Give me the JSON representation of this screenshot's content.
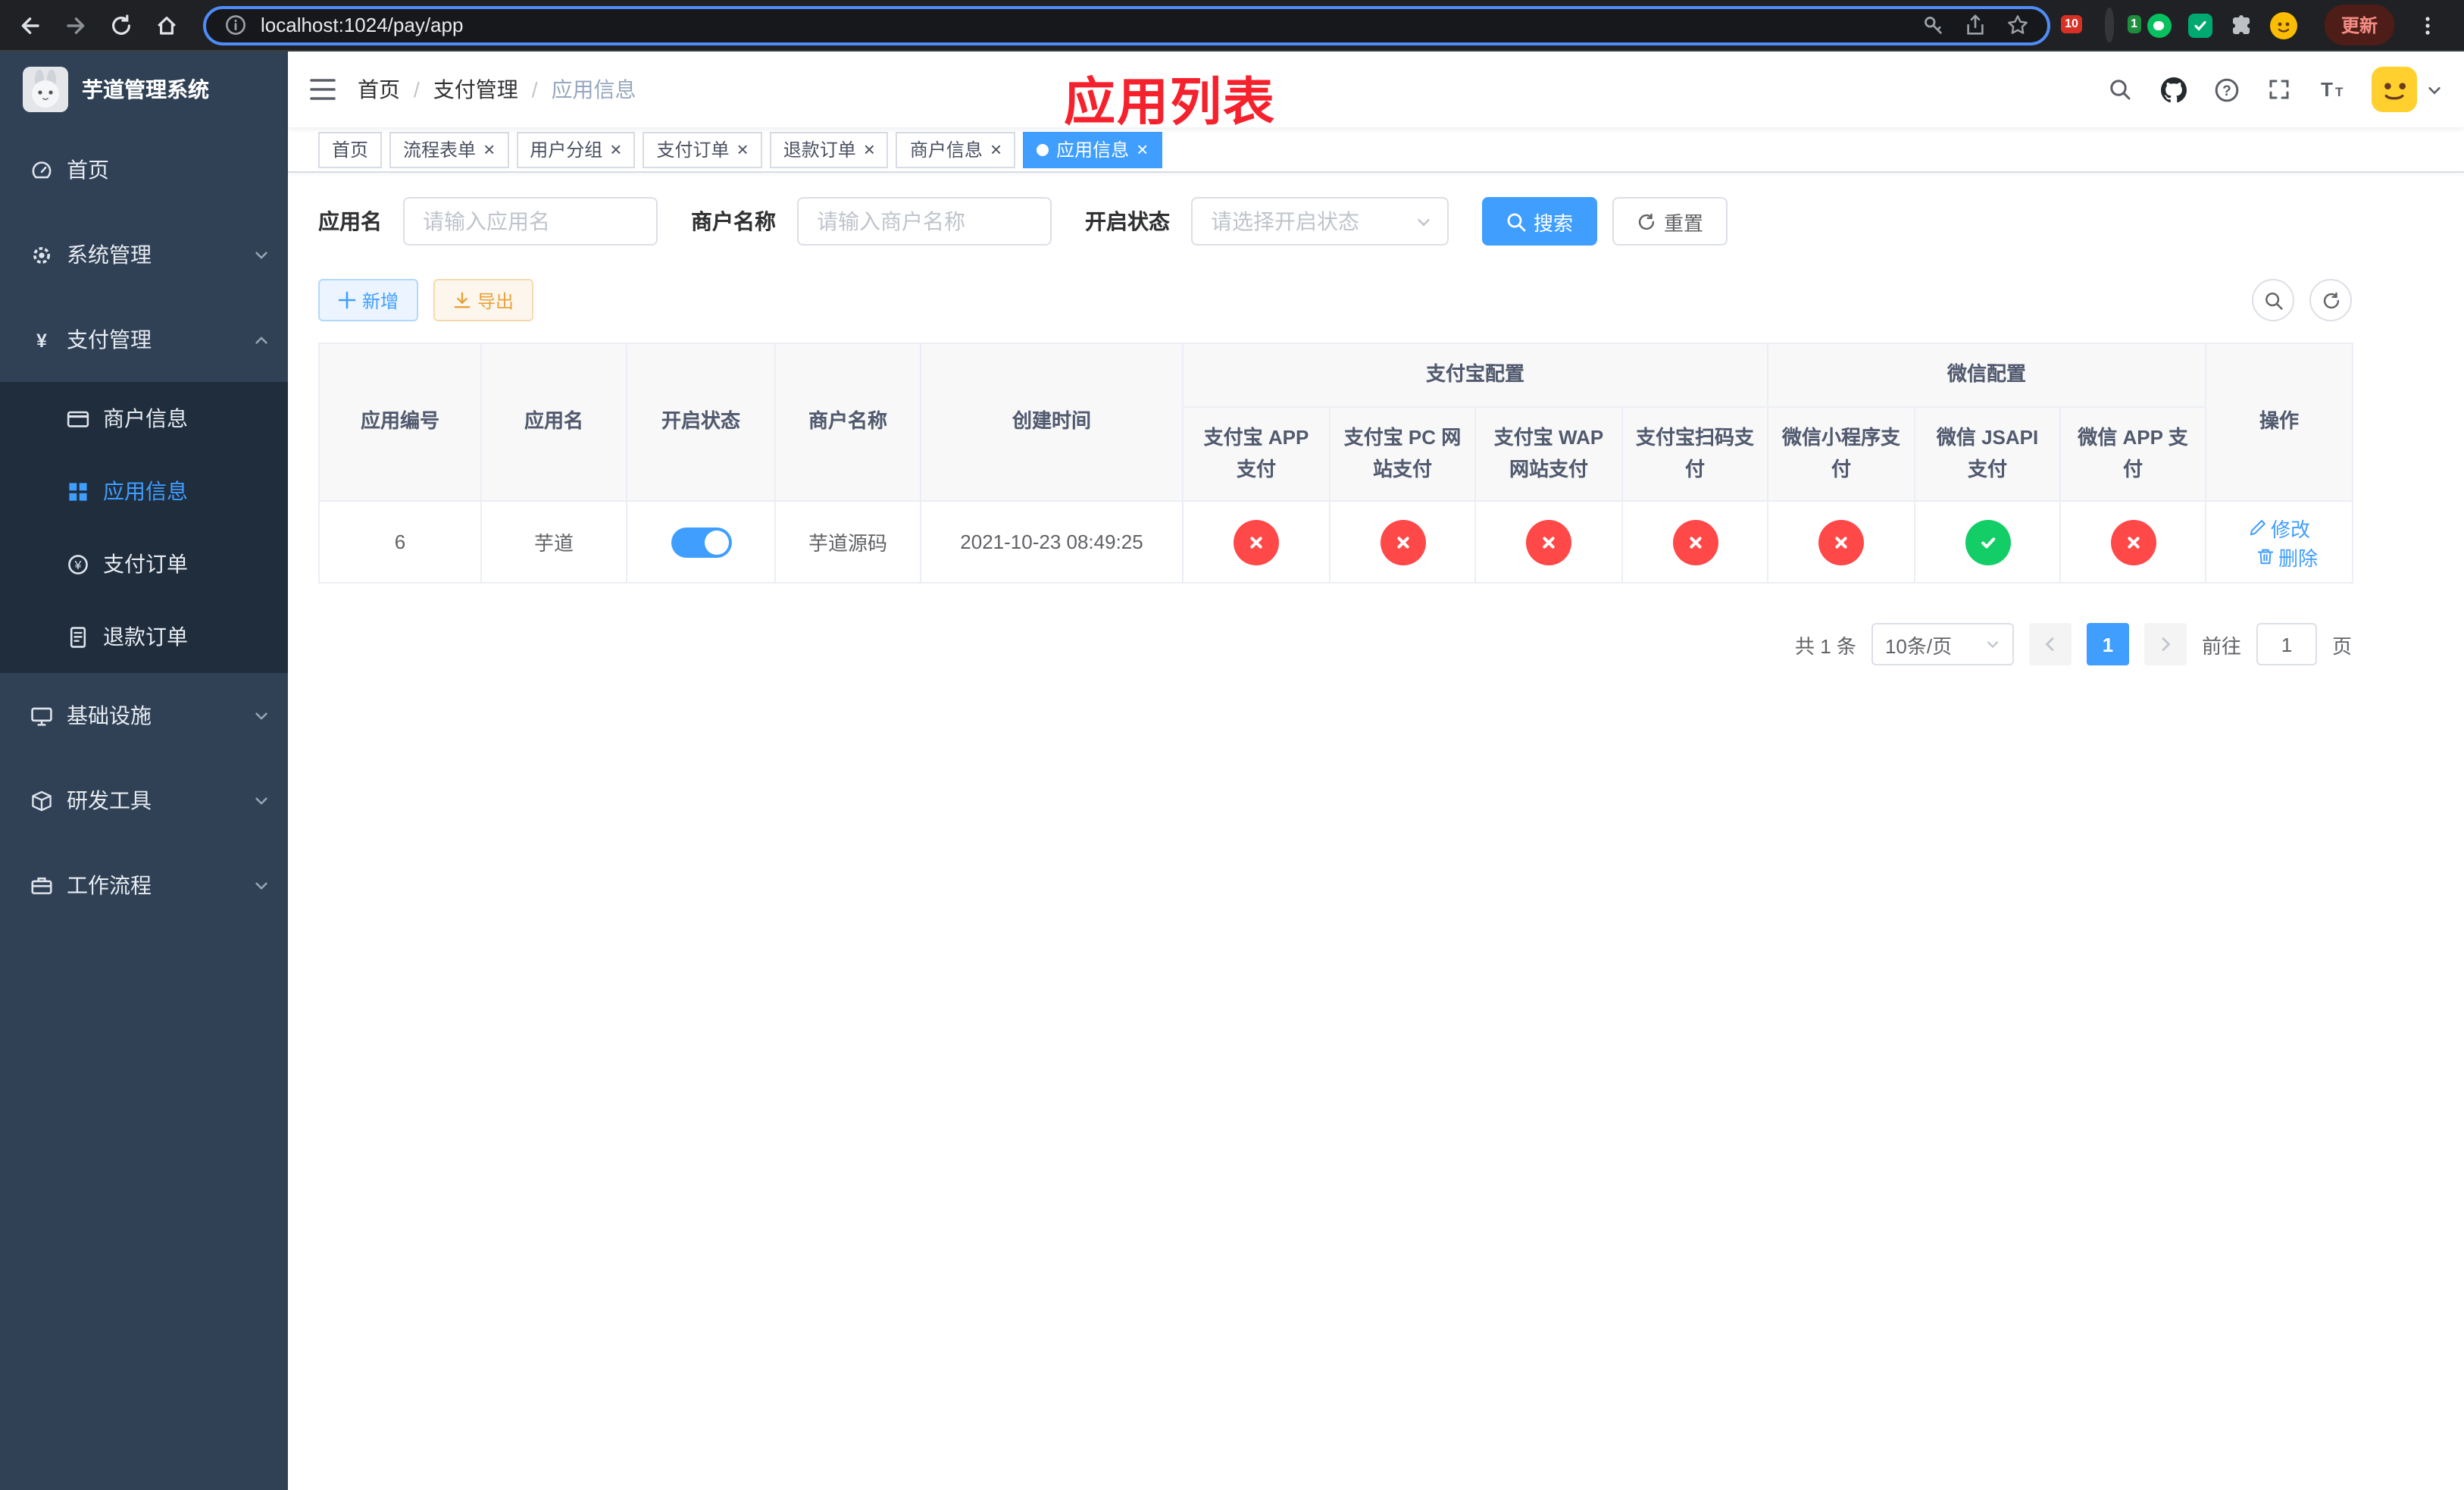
{
  "colors": {
    "primary": "#409EFF",
    "status_enabled": "#13ce66",
    "status_disabled": "#ff4949",
    "annotation_red": "#f5222d",
    "sidebar_bg": "#304156",
    "sidebar_submenu_bg": "#1f2d3d"
  },
  "browser": {
    "url": "localhost:1024/pay/app",
    "update_button": "更新",
    "extension_badge_a": "10",
    "extension_badge_b": "1"
  },
  "sidebar": {
    "title": "芋道管理系统",
    "items": [
      {
        "label": "首页",
        "icon": "dashboard-icon"
      },
      {
        "label": "系统管理",
        "icon": "gear-icon",
        "chevron": "down"
      },
      {
        "label": "支付管理",
        "icon": "yen-icon",
        "chevron": "up",
        "children": [
          {
            "label": "商户信息",
            "icon": "credit-card-icon"
          },
          {
            "label": "应用信息",
            "icon": "grid-icon",
            "active": true
          },
          {
            "label": "支付订单",
            "icon": "coin-icon"
          },
          {
            "label": "退款订单",
            "icon": "document-icon"
          }
        ]
      },
      {
        "label": "基础设施",
        "icon": "monitor-icon",
        "chevron": "down"
      },
      {
        "label": "研发工具",
        "icon": "box-icon",
        "chevron": "down"
      },
      {
        "label": "工作流程",
        "icon": "workflow-icon",
        "chevron": "down"
      }
    ]
  },
  "navbar": {
    "breadcrumb": [
      "首页",
      "支付管理",
      "应用信息"
    ],
    "annotation_title": "应用列表"
  },
  "tabs": [
    {
      "label": "首页",
      "closable": false,
      "active": false
    },
    {
      "label": "流程表单",
      "closable": true,
      "active": false
    },
    {
      "label": "用户分组",
      "closable": true,
      "active": false
    },
    {
      "label": "支付订单",
      "closable": true,
      "active": false
    },
    {
      "label": "退款订单",
      "closable": true,
      "active": false
    },
    {
      "label": "商户信息",
      "closable": true,
      "active": false
    },
    {
      "label": "应用信息",
      "closable": true,
      "active": true
    }
  ],
  "filter": {
    "app_name": {
      "label": "应用名",
      "placeholder": "请输入应用名",
      "value": ""
    },
    "merchant_name": {
      "label": "商户名称",
      "placeholder": "请输入商户名称",
      "value": ""
    },
    "status": {
      "label": "开启状态",
      "placeholder": "请选择开启状态",
      "value": ""
    },
    "search_button": "搜索",
    "reset_button": "重置"
  },
  "toolbar": {
    "add_button": "新增",
    "export_button": "导出"
  },
  "table": {
    "headers": {
      "app_id": "应用编号",
      "app_name": "应用名",
      "status": "开启状态",
      "merchant_name": "商户名称",
      "created_at": "创建时间",
      "alipay_group": "支付宝配置",
      "wechat_group": "微信配置",
      "alipay_cols": [
        "支付宝 APP 支付",
        "支付宝 PC 网站支付",
        "支付宝 WAP 网站支付",
        "支付宝扫码支付"
      ],
      "wechat_cols": [
        "微信小程序支付",
        "微信 JSAPI 支付",
        "微信 APP 支付"
      ],
      "actions": "操作"
    },
    "row": {
      "app_id": "6",
      "app_name": "芋道",
      "status_on": true,
      "merchant_name": "芋道源码",
      "created_at": "2021-10-23 08:49:25",
      "config_status": [
        "disabled",
        "disabled",
        "disabled",
        "disabled",
        "disabled",
        "enabled",
        "disabled"
      ],
      "edit_link": "修改",
      "delete_link": "删除"
    }
  },
  "pagination": {
    "total_text": "共 1 条",
    "page_size": "10条/页",
    "current_page": "1",
    "jump_prefix": "前往",
    "jump_value": "1",
    "jump_suffix": "页"
  }
}
